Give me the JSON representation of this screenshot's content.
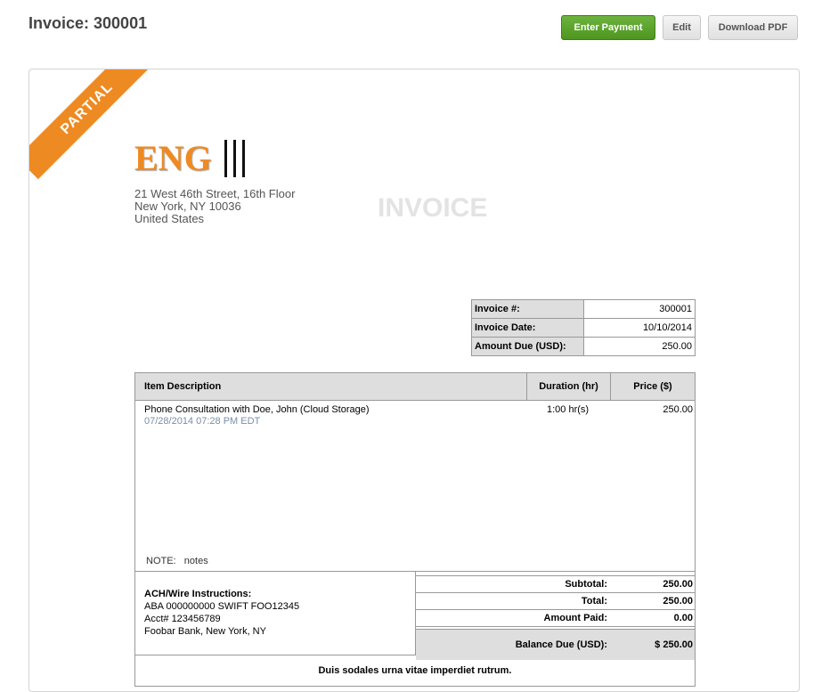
{
  "header": {
    "title": "Invoice: 300001",
    "enter_payment": "Enter Payment",
    "edit": "Edit",
    "download_pdf": "Download PDF"
  },
  "ribbon": "PARTIAL",
  "company": {
    "logo_text": "ENG",
    "address": [
      "21 West 46th Street, 16th Floor",
      "New York, NY 10036",
      "United States"
    ]
  },
  "watermark": "INVOICE",
  "meta": [
    {
      "label": "Invoice #:",
      "value": "300001"
    },
    {
      "label": "Invoice Date:",
      "value": "10/10/2014"
    },
    {
      "label": "Amount Due (USD):",
      "value": "250.00"
    }
  ],
  "items": {
    "headers": {
      "description": "Item Description",
      "duration": "Duration (hr)",
      "price": "Price ($)"
    },
    "rows": [
      {
        "description": "Phone Consultation with Doe, John (Cloud Storage)",
        "date": "07/28/2014 07:28 PM EDT",
        "duration": "1:00 hr(s)",
        "price": "250.00"
      }
    ],
    "note_label": "NOTE:",
    "note_value": "notes"
  },
  "ach": {
    "title": "ACH/Wire Instructions:",
    "lines": [
      "ABA 000000000 SWIFT FOO12345",
      "Acct# 123456789",
      "Foobar Bank, New York, NY"
    ]
  },
  "totals": {
    "subtotal_label": "Subtotal:",
    "subtotal": "250.00",
    "total_label": "Total:",
    "total": "250.00",
    "paid_label": "Amount Paid:",
    "paid": "0.00",
    "balance_label": "Balance Due (USD):",
    "balance": "$ 250.00"
  },
  "footer_message": "Duis sodales urna vitae imperdiet rutrum.",
  "colors": {
    "accent": "#ee8a22",
    "button_green": "#5ca52d"
  }
}
